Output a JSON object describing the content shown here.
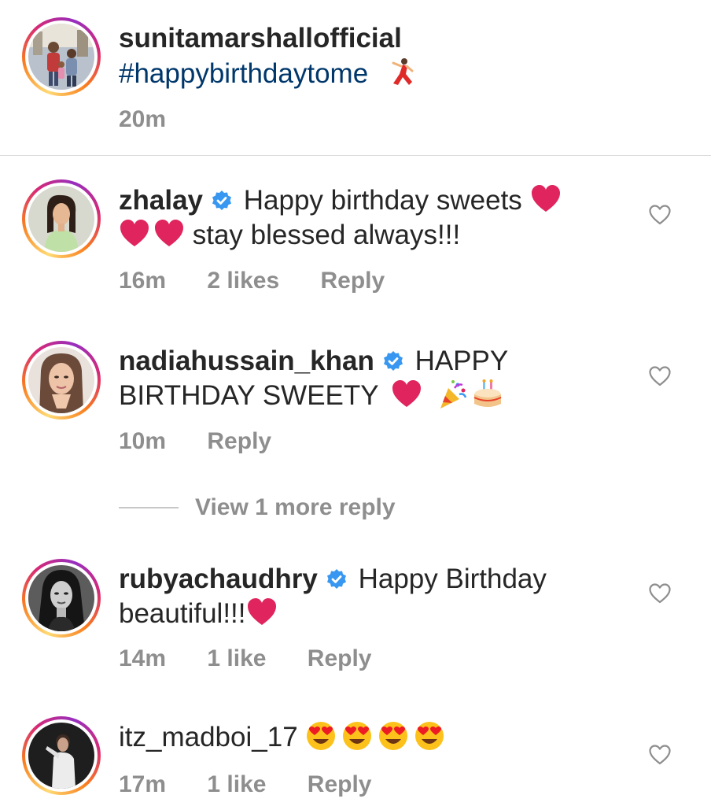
{
  "post": {
    "username": "sunitamarshallofficial",
    "caption": "#happybirthdaytome",
    "caption_emoji": "dancer-emoji",
    "time": "20m"
  },
  "comments": [
    {
      "username": "zhalay",
      "verified": true,
      "text_line1": "Happy birthday sweets",
      "text_line2": "stay blessed always!!!",
      "time": "16m",
      "likes": "2 likes",
      "reply_label": "Reply"
    },
    {
      "username": "nadiahussain_khan",
      "verified": true,
      "text_line1": "HAPPY",
      "text_line2": "BIRTHDAY SWEETY",
      "time": "10m",
      "reply_label": "Reply",
      "view_replies": "View 1 more reply"
    },
    {
      "username": "rubyachaudhry",
      "verified": true,
      "text_line1": "Happy Birthday",
      "text_line2": "beautiful!!!",
      "time": "14m",
      "likes": "1 like",
      "reply_label": "Reply"
    },
    {
      "username": "itz_madboi_17",
      "verified": false,
      "time": "17m",
      "likes": "1 like",
      "reply_label": "Reply"
    }
  ],
  "colors": {
    "text": "#262626",
    "meta": "#8e8e8e",
    "hashtag": "#00376b",
    "verified": "#3897f0",
    "heart_emoji": "#e0245e"
  }
}
